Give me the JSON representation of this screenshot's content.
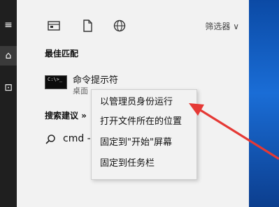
{
  "toolbar": {
    "filter_label": "筛选器 ∨"
  },
  "best_match": {
    "title": "最佳匹配",
    "app_name": "命令提示符",
    "app_sub": "桌面",
    "cmd_glyph": "C:\\>_"
  },
  "search_suggestions": {
    "title": "搜索建议 »",
    "query": "cmd -"
  },
  "context_menu": {
    "items": [
      "以管理员身份运行",
      "打开文件所在的位置",
      "固定到\"开始\"屏幕",
      "固定到任务栏"
    ]
  },
  "rail": {
    "menu_icon": "≡",
    "home_icon": "⌂",
    "screen_icon": "⊡"
  },
  "colors": {
    "arrow": "#e53935",
    "rail": "#1f1f1f"
  }
}
